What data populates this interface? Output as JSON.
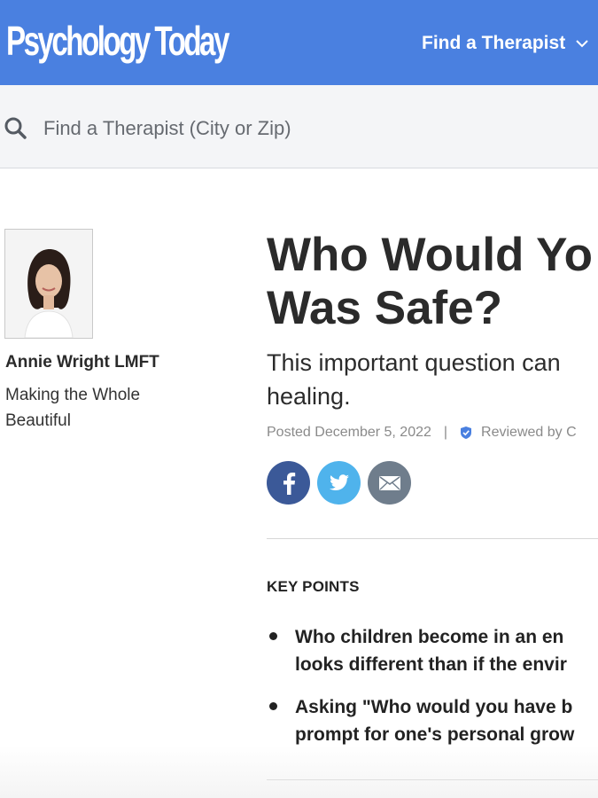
{
  "header": {
    "logo_text": "Psychology Today",
    "nav_find_therapist": "Find a Therapist",
    "brand_color": "#4a80e0"
  },
  "search": {
    "placeholder": "Find a Therapist (City or Zip)",
    "value": ""
  },
  "author": {
    "name": "Annie Wright LMFT",
    "tagline": "Making the Whole Beautiful"
  },
  "article": {
    "title_line1": "Who Would Yo",
    "title_line2": "Was Safe?",
    "subtitle": "This important question can healing.",
    "posted": "Posted December 5, 2022",
    "separator": "|",
    "reviewed": "Reviewed by C"
  },
  "share": {
    "icons": [
      "facebook-icon",
      "twitter-icon",
      "email-icon"
    ],
    "colors": {
      "facebook": "#3b5998",
      "twitter": "#4fb3ec",
      "email": "#6f7d8c"
    }
  },
  "key_points": {
    "heading": "KEY POINTS",
    "items": [
      {
        "line1": "Who children become in an en",
        "line2": "looks different than if the envir"
      },
      {
        "line1": "Asking \"Who would you have b",
        "line2": "prompt for one's personal grow"
      }
    ]
  }
}
